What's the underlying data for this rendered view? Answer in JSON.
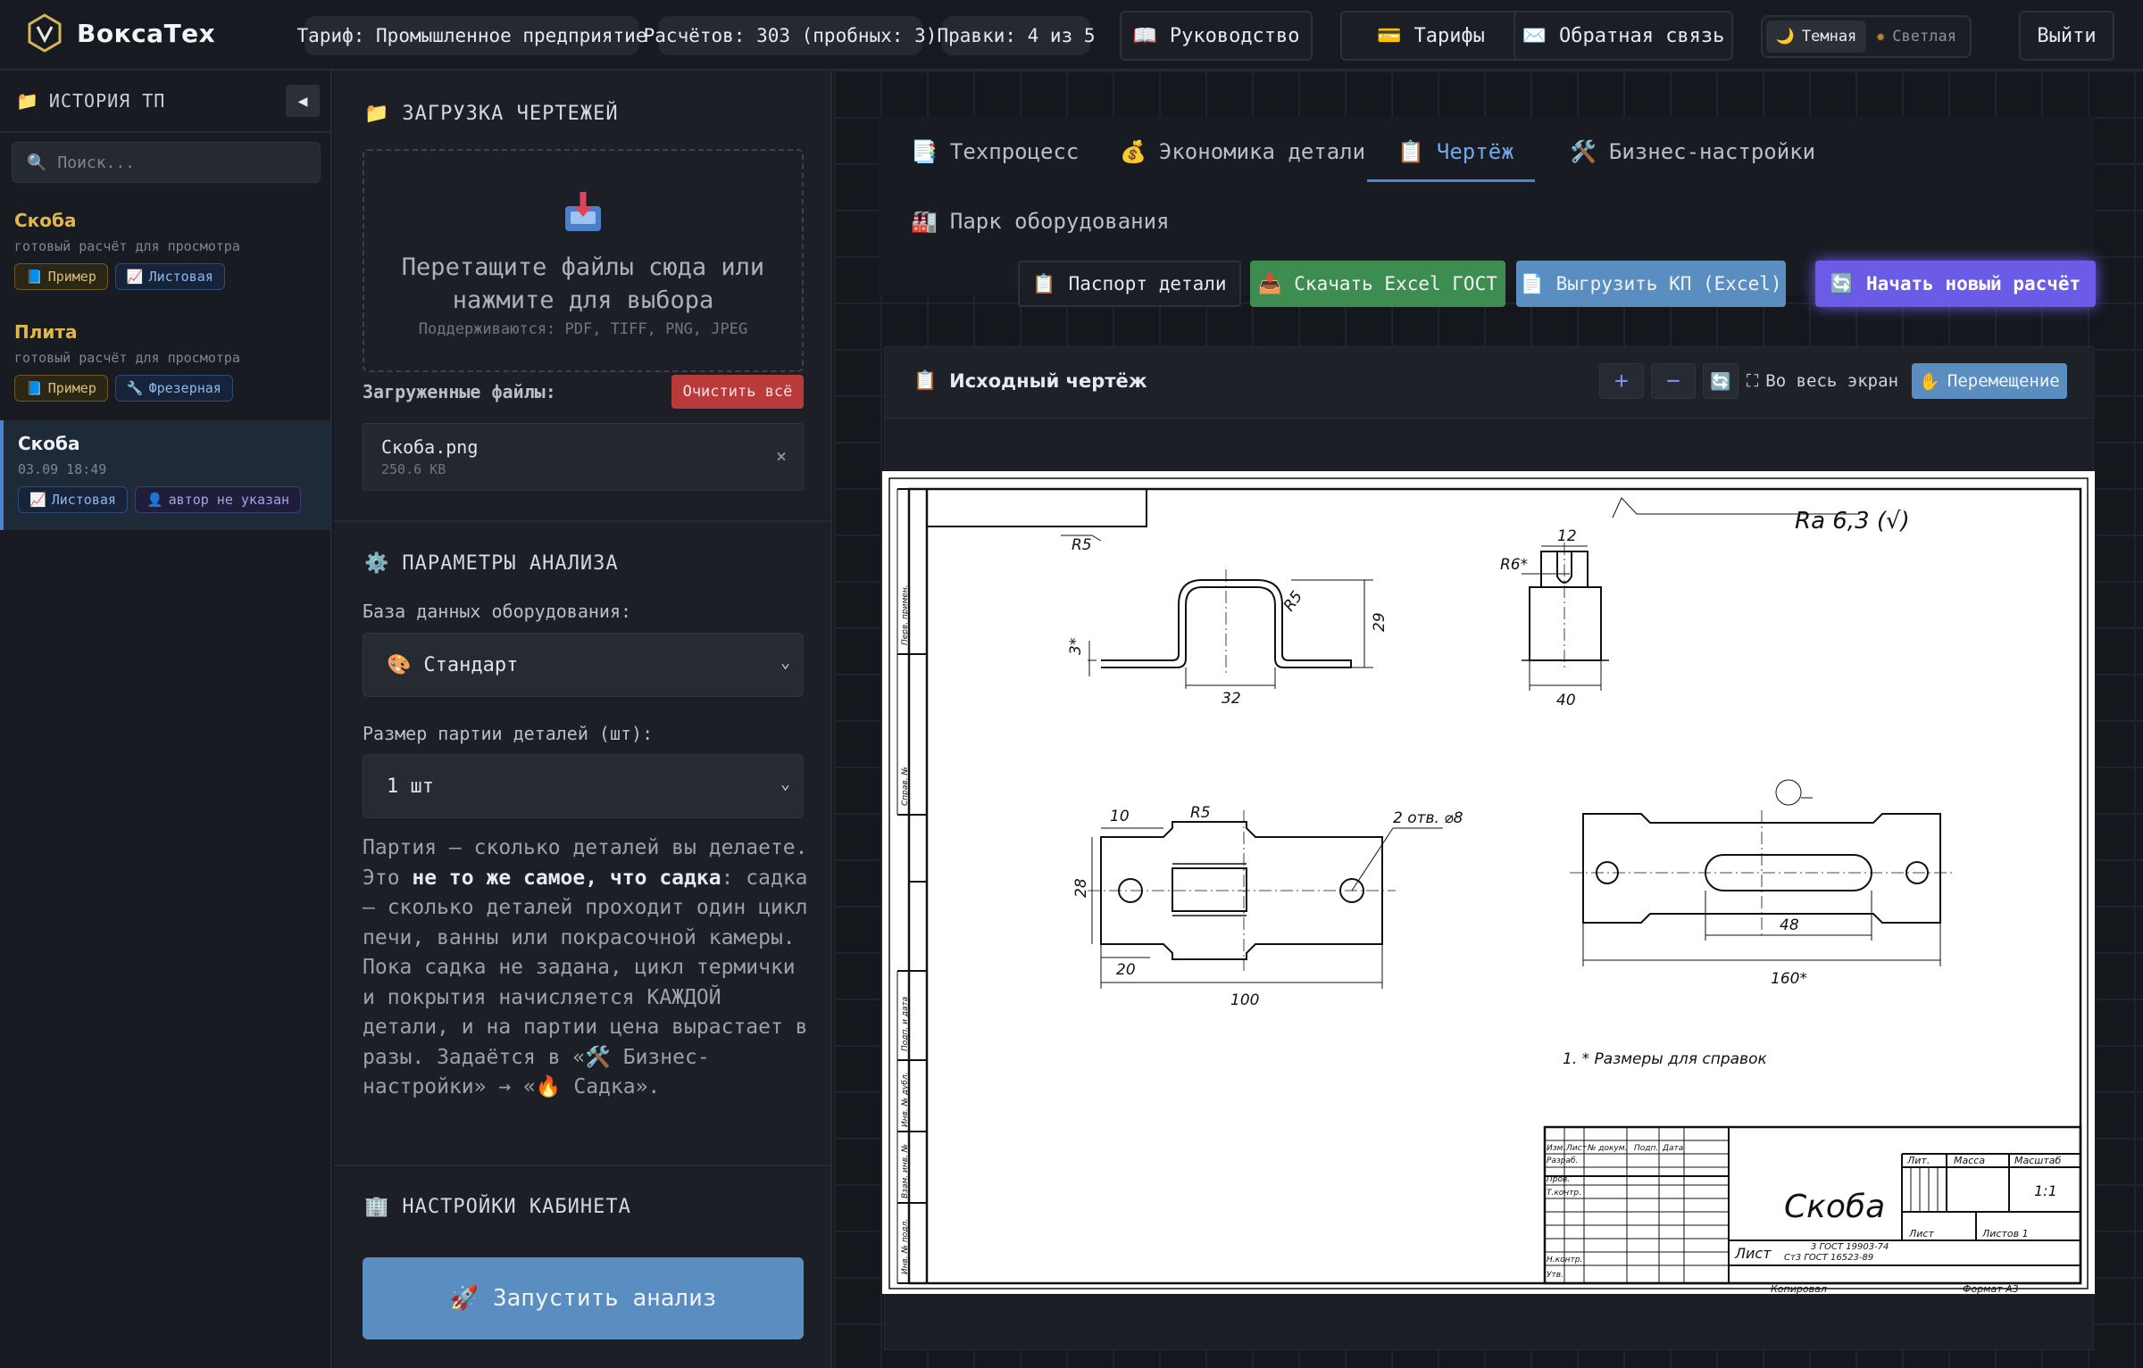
{
  "app": {
    "brand": "ВоксаТех"
  },
  "header": {
    "plan": "Тариф: Промышленное предприятие",
    "calcs": "Расчётов: 303 (пробных: 3)",
    "edits": "Правки: 4 из 5",
    "guide": "Руководство",
    "tariffs": "Тарифы",
    "feedback": "Обратная связь",
    "theme_dark": "Темная",
    "theme_light": "Светлая",
    "logout": "Выйти"
  },
  "sidebar": {
    "title": "ИСТОРИЯ ТП",
    "search_placeholder": "Поиск...",
    "items": [
      {
        "name": "Скоба",
        "sub": "готовый расчёт для просмотра",
        "tags": [
          "Пример",
          "Листовая"
        ]
      },
      {
        "name": "Плита",
        "sub": "готовый расчёт для просмотра",
        "tags": [
          "Пример",
          "Фрезерная"
        ]
      },
      {
        "name": "Скоба",
        "sub": "03.09 18:49",
        "tags": [
          "Листовая",
          "автор не указан"
        ]
      }
    ]
  },
  "upload": {
    "title": "ЗАГРУЗКА ЧЕРТЕЖЕЙ",
    "drop_text": "Перетащите файлы сюда или нажмите для выбора",
    "supported": "Поддерживаются: PDF, TIFF, PNG, JPEG",
    "loaded_label": "Загруженные файлы:",
    "clear_all": "Очистить всё",
    "file": {
      "name": "Скоба.png",
      "size": "250.6 KB",
      "remove": "×"
    }
  },
  "analysis": {
    "title": "ПАРАМЕТРЫ АНАЛИЗА",
    "db_label": "База данных оборудования:",
    "db_value": "Стандарт",
    "batch_label": "Размер партии деталей (шт):",
    "batch_value": "1 шт",
    "note_1": "Партия — сколько деталей вы делаете. Это ",
    "note_bold": "не то же самое, что садка",
    "note_2": ": садка — сколько деталей проходит один цикл печи, ванны или покрасочной камеры. Пока садка не задана, цикл термички и покрытия начисляется КАЖДОЙ детали, и на партии цена вырастает в разы. Задаётся в «🛠️ Бизнес-настройки» → «🔥 Садка».",
    "cabinet_title": "НАСТРОЙКИ КАБИНЕТА",
    "run": "Запустить анализ"
  },
  "tabs": {
    "process": "Техпроцесс",
    "economics": "Экономика детали",
    "drawing": "Чертёж",
    "business": "Бизнес-настройки",
    "fleet": "Парк оборудования"
  },
  "actions": {
    "passport": "Паспорт детали",
    "excel_gost": "Скачать Excel ГОСТ",
    "kp_excel": "Выгрузить КП (Excel)",
    "new_calc": "Начать новый расчёт"
  },
  "viewer": {
    "title": "Исходный чертёж",
    "zoom_in": "+",
    "zoom_out": "−",
    "fullscreen": "Во весь экран",
    "pan": "Перемещение"
  },
  "drawing": {
    "roughness": "Ra 6,3 (√)",
    "dims": {
      "r5_top": "R5",
      "r5_right": "R5",
      "d3": "3*",
      "d32": "32",
      "d29": "29",
      "d12": "12",
      "r6": "R6*",
      "d40": "40",
      "d10": "10",
      "r5_mid": "R5",
      "holes": "2 отв. ⌀8",
      "d28": "28",
      "d20": "20",
      "d100": "100",
      "d48": "48",
      "d160": "160*"
    },
    "note": "1.  * Размеры для справок",
    "title_block": {
      "name": "Скоба",
      "material_1": "3 ГОСТ 19903-74",
      "material_2": "Ст3 ГОСТ 16523-89",
      "sheet_prefix": "Лист",
      "lit": "Лит.",
      "mass": "Масса",
      "scale": "Масштаб",
      "scale_val": "1:1",
      "sheet": "Лист",
      "sheets": "Листов  1",
      "copied": "Копировал",
      "format": "Формат   А3",
      "rows": [
        "Изм.",
        "Лист",
        "№ докум.",
        "Подп.",
        "Дата",
        "Разраб.",
        "Пров.",
        "Т.контр.",
        "Н.контр.",
        "Утв."
      ],
      "side": [
        "Перв. примен.",
        "Справ. №",
        "Подп. и дата",
        "Инв. № дубл.",
        "Взам. инв. №",
        "Подп. и дата",
        "Инв. № подл."
      ]
    }
  }
}
